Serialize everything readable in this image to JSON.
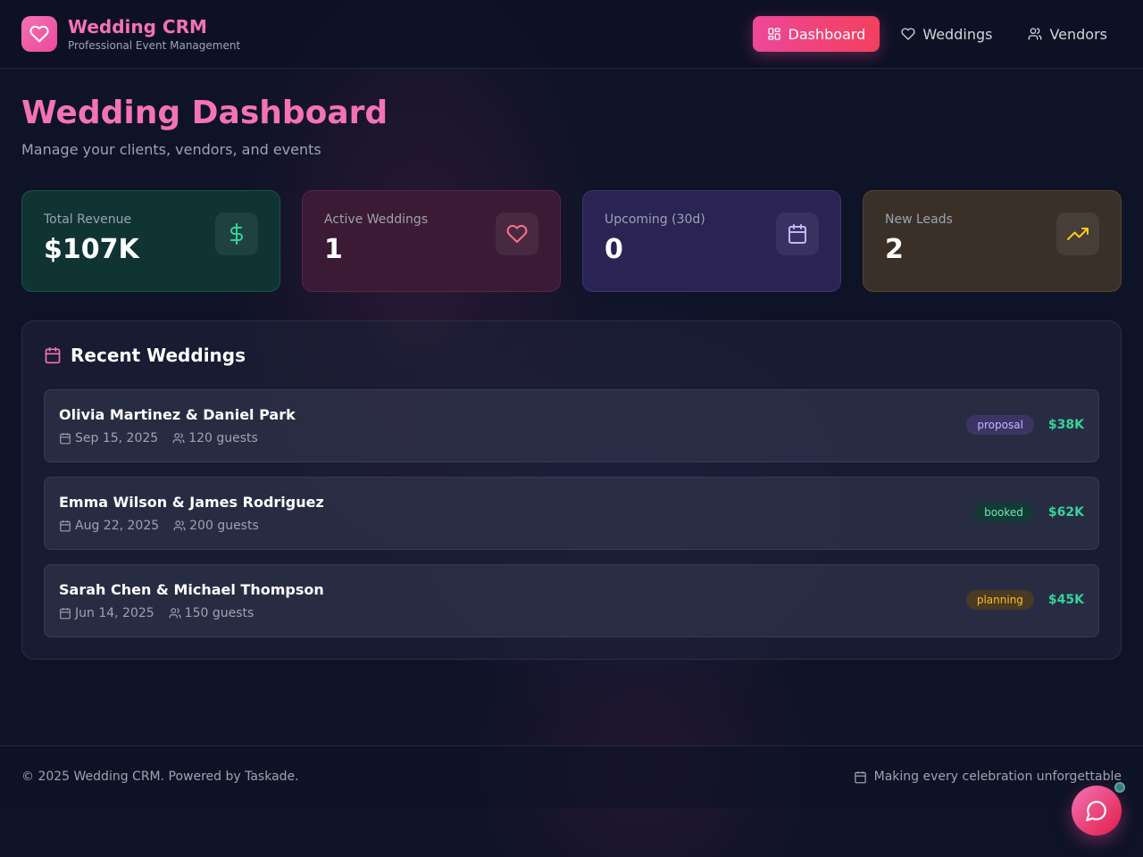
{
  "brand": {
    "title": "Wedding CRM",
    "subtitle": "Professional Event Management",
    "logo_icon": "heart-icon"
  },
  "nav": [
    {
      "label": "Dashboard",
      "icon": "grid-icon",
      "active": true
    },
    {
      "label": "Weddings",
      "icon": "heart-icon",
      "active": false
    },
    {
      "label": "Vendors",
      "icon": "users-icon",
      "active": false
    }
  ],
  "page": {
    "title": "Wedding Dashboard",
    "subtitle": "Manage your clients, vendors, and events"
  },
  "stats": [
    {
      "label": "Total Revenue",
      "value": "$107K",
      "icon": "dollar-icon",
      "color": "#34d399"
    },
    {
      "label": "Active Weddings",
      "value": "1",
      "icon": "heart-icon",
      "color": "#fb7185"
    },
    {
      "label": "Upcoming (30d)",
      "value": "0",
      "icon": "calendar-icon",
      "color": "#c4b5fd"
    },
    {
      "label": "New Leads",
      "value": "2",
      "icon": "trending-up-icon",
      "color": "#facc15"
    }
  ],
  "recent": {
    "title": "Recent Weddings",
    "items": [
      {
        "couple": "Olivia Martinez & Daniel Park",
        "date": "Sep 15, 2025",
        "guests": "120 guests",
        "status": "proposal",
        "amount": "$38K"
      },
      {
        "couple": "Emma Wilson & James Rodriguez",
        "date": "Aug 22, 2025",
        "guests": "200 guests",
        "status": "booked",
        "amount": "$62K"
      },
      {
        "couple": "Sarah Chen & Michael Thompson",
        "date": "Jun 14, 2025",
        "guests": "150 guests",
        "status": "planning",
        "amount": "$45K"
      }
    ]
  },
  "status_colors": {
    "proposal": {
      "bg": "#3b3566",
      "fg": "#c4b5fd"
    },
    "booked": {
      "bg": "#143a35",
      "fg": "#6ee7b7"
    },
    "planning": {
      "bg": "#4a3a24",
      "fg": "#fbbf24"
    }
  },
  "footer": {
    "copyright": "© 2025 Wedding CRM. Powered by Taskade.",
    "tagline": "Making every celebration unforgettable"
  },
  "chat": {
    "icon": "chat-bubble-icon"
  }
}
